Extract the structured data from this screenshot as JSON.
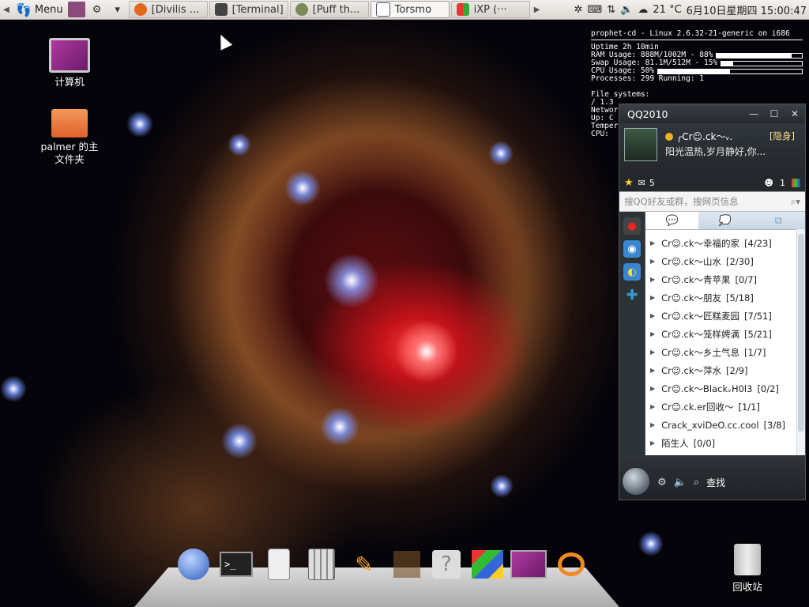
{
  "top_panel": {
    "menu_label": "Menu",
    "tasks": [
      {
        "label": "[Divilis ..."
      },
      {
        "label": "[Terminal]"
      },
      {
        "label": "[Puff th..."
      },
      {
        "label": "Torsmo"
      },
      {
        "label": "iXP (···"
      }
    ],
    "temperature": "21 °C",
    "clock": "6月10日星期四 15:00:47",
    "icons": [
      "firefox-icon",
      "terminal-icon",
      "puff-icon",
      "window-icon",
      "ixp-icon",
      "keyboard-icon",
      "network-icon",
      "volume-icon",
      "weather-icon"
    ]
  },
  "desktop": {
    "computer_label": "计算机",
    "home_label_line1": "palmer 的主",
    "home_label_line2": "文件夹",
    "trash_label": "回收站"
  },
  "conky": {
    "header": "prophet-cd - Linux 2.6.32-21-generic on i686",
    "uptime": "Uptime 2h 10min",
    "ram": "RAM Usage: 888M/1002M - 88%",
    "ram_pct": 88,
    "swap": "Swap Usage: 81.1M/512M - 15%",
    "swap_pct": 15,
    "cpu": "CPU Usage: 50%",
    "cpu_pct": 50,
    "processes": "Processes: 299  Running: 1",
    "fs": "File systems:",
    "fs_line": "  / 1.3",
    "net": "Networ",
    "up": "  Up: C",
    "temp": "Temper",
    "cpu2": "  CPU:"
  },
  "qq": {
    "title": "QQ2010",
    "nickname": "╭Cr☺.ck～ᵥ.",
    "status": "[隐身]",
    "signature": "阳光温热,岁月静好,你...",
    "mail_count": "5",
    "friend_count": "1",
    "search_placeholder": "搜QQ好友或群，搜网页信息",
    "groups": [
      {
        "name": "Cr☺.ck～幸福的家",
        "count": "[4/23]"
      },
      {
        "name": "Cr☺.ck～山水",
        "count": "[2/30]"
      },
      {
        "name": "Cr☺.ck～青苹果",
        "count": "[0/7]"
      },
      {
        "name": "Cr☺.ck～朋友",
        "count": "[5/18]"
      },
      {
        "name": "Cr☺.ck～匠糕麦园",
        "count": "[7/51]"
      },
      {
        "name": "Cr☺.ck～笼样娉满",
        "count": "[5/21]"
      },
      {
        "name": "Cr☺.ck～乡土气息",
        "count": "[1/7]"
      },
      {
        "name": "Cr☺.ck～萍水",
        "count": "[2/9]"
      },
      {
        "name": "Cr☺.ck～BlackᵥH0l3",
        "count": "[0/2]"
      },
      {
        "name": "Cr☺.ck.er回收～",
        "count": "[1/1]"
      },
      {
        "name": "Crack_xviDeO.cc.cool",
        "count": "[3/8]"
      },
      {
        "name": "陌生人",
        "count": "[0/0]"
      }
    ],
    "find_label": "查找"
  },
  "dock": {
    "items": [
      "gnome-do-icon",
      "terminal-icon",
      "ipod-icon",
      "calculator-icon",
      "cleaner-icon",
      "blank-icon",
      "help-icon",
      "xp-icon",
      "monitor-icon",
      "blender-icon"
    ]
  }
}
